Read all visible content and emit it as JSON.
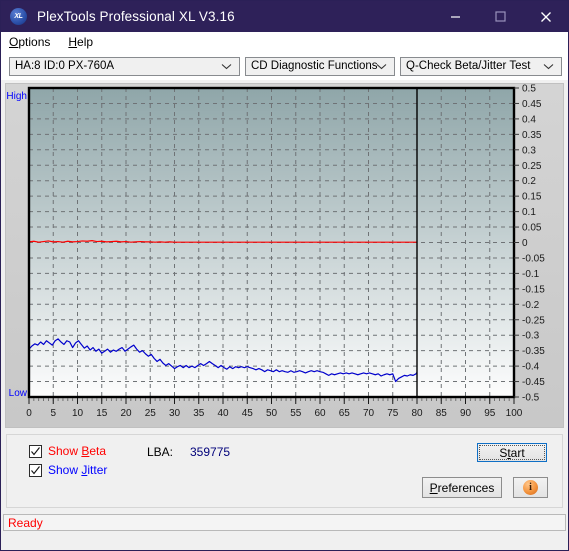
{
  "window": {
    "title": "PlexTools Professional XL V3.16",
    "icon": "XL",
    "app_icon_name": "plextools-logo-icon",
    "controls": {
      "minimize": "minimize-icon",
      "maximize": "maximize-icon",
      "close": "close-icon"
    },
    "titlebar_color": "#2e2159"
  },
  "menubar": {
    "items": [
      {
        "label": "Options",
        "accel": "O"
      },
      {
        "label": "Help",
        "accel": "H"
      }
    ]
  },
  "toolbar": {
    "drive_select": {
      "value": "HA:8 ID:0  PX-760A",
      "options": [
        "HA:8 ID:0  PX-760A"
      ]
    },
    "function_select": {
      "value": "CD Diagnostic Functions",
      "options": [
        "CD Diagnostic Functions"
      ]
    },
    "test_select": {
      "value": "Q-Check Beta/Jitter Test",
      "options": [
        "Q-Check Beta/Jitter Test"
      ]
    }
  },
  "options_panel": {
    "show_beta": {
      "label_pre": "Show ",
      "label_accel": "B",
      "label_post": "eta",
      "checked": true,
      "color": "#ff0000"
    },
    "show_jitter": {
      "label_pre": "Show ",
      "label_accel": "J",
      "label_post": "itter",
      "checked": true,
      "color": "#0000ff"
    },
    "lba_label": "LBA:",
    "lba_value": "359775",
    "start_button": {
      "label_pre": "S",
      "label_accel": "t",
      "label_post": "art",
      "focused": true
    },
    "preferences_button": {
      "label_pre": "",
      "label_accel": "P",
      "label_post": "references"
    },
    "info_button": {
      "glyph": "i",
      "name": "info-icon"
    }
  },
  "statusbar": {
    "text": "Ready",
    "color": "#ff0000"
  },
  "chart_data": {
    "type": "line",
    "title": "",
    "xlabel": "",
    "ylabel": "",
    "xlim": [
      0,
      100
    ],
    "ylim": [
      -0.5,
      0.5
    ],
    "grid": true,
    "legend": "none",
    "y_edge_labels": {
      "top": "High",
      "bottom": "Low",
      "color": "#0000ff"
    },
    "x_ticks": [
      0,
      5,
      10,
      15,
      20,
      25,
      30,
      35,
      40,
      45,
      50,
      55,
      60,
      65,
      70,
      75,
      80,
      85,
      90,
      95,
      100
    ],
    "y_ticks": [
      0.5,
      0.45,
      0.4,
      0.35,
      0.3,
      0.25,
      0.2,
      0.15,
      0.1,
      0.05,
      0,
      -0.05,
      -0.1,
      -0.15,
      -0.2,
      -0.25,
      -0.3,
      -0.35,
      -0.4,
      -0.45,
      -0.5
    ],
    "y_tick_labels": [
      "0.5",
      "0.45",
      "0.4",
      "0.35",
      "0.3",
      "0.25",
      "0.2",
      "0.15",
      "0.1",
      "0.05",
      "0",
      "-0.05",
      "-0.1",
      "-0.15",
      "-0.2",
      "-0.25",
      "-0.3",
      "-0.35",
      "-0.4",
      "-0.45",
      "-0.5"
    ],
    "plot_bg_gradient": [
      "#8fa6a9",
      "#fdfdfd"
    ],
    "data_end_marker_x": 80,
    "series": [
      {
        "name": "Beta",
        "color": "#ff0000",
        "x": [
          0,
          1,
          2,
          3,
          4,
          5,
          6,
          7,
          8,
          9,
          10,
          11,
          12,
          13,
          14,
          15,
          16,
          17,
          18,
          19,
          20,
          21,
          22,
          23,
          24,
          25,
          26,
          27,
          28,
          29,
          30,
          31,
          32,
          33,
          34,
          35,
          36,
          37,
          38,
          39,
          40,
          41,
          42,
          43,
          44,
          45,
          46,
          47,
          48,
          49,
          50,
          51,
          52,
          53,
          54,
          55,
          56,
          57,
          58,
          59,
          60,
          61,
          62,
          63,
          64,
          65,
          66,
          67,
          68,
          69,
          70,
          71,
          72,
          73,
          74,
          75,
          76,
          77,
          78,
          79,
          80
        ],
        "values": [
          0.002,
          0.004,
          0.001,
          0.003,
          0.005,
          0.002,
          0.003,
          0.001,
          0.004,
          0.002,
          0.003,
          0.005,
          0.004,
          0.006,
          0.003,
          0.004,
          0.002,
          0.003,
          0.004,
          0.002,
          0.003,
          0.001,
          0.002,
          0.003,
          0.002,
          0.002,
          0.001,
          0.002,
          0.001,
          0.002,
          0.001,
          0.001,
          0.001,
          0.001,
          0.001,
          0.001,
          0.001,
          0.001,
          0.001,
          0.001,
          0.001,
          0.001,
          0.001,
          0.001,
          0.001,
          0.001,
          0.001,
          0.001,
          0.001,
          0.001,
          0.001,
          0.001,
          0.001,
          0.001,
          0.001,
          0.001,
          0.001,
          0.001,
          0.001,
          0.001,
          0.001,
          0.001,
          0.001,
          0.001,
          0.001,
          0.001,
          0.001,
          0.001,
          0.001,
          0.001,
          0.001,
          0.001,
          0.001,
          0.001,
          0.001,
          0.001,
          0.001,
          0.001,
          0.001,
          0.001,
          0.001
        ]
      },
      {
        "name": "Jitter",
        "color": "#0000cc",
        "x": [
          0,
          0.6,
          1.2,
          1.8,
          2.4,
          3,
          3.6,
          4.2,
          4.8,
          5.4,
          6,
          6.6,
          7.2,
          7.8,
          8.4,
          9,
          9.6,
          10.2,
          10.8,
          11.4,
          12,
          12.6,
          13.2,
          13.8,
          14.4,
          15,
          15.6,
          16.2,
          16.8,
          17.4,
          18,
          18.6,
          19.2,
          19.8,
          20.4,
          21,
          21.6,
          22.2,
          22.8,
          23.4,
          24,
          24.6,
          25.2,
          25.8,
          26.4,
          27,
          27.6,
          28.2,
          28.8,
          29.4,
          30,
          30.6,
          31.2,
          31.8,
          32.4,
          33,
          33.6,
          34.2,
          34.8,
          35.4,
          36,
          36.6,
          37.2,
          37.8,
          38.4,
          39,
          39.6,
          40.2,
          40.8,
          41.4,
          42,
          42.6,
          43.2,
          43.8,
          44.4,
          45,
          45.6,
          46.2,
          46.8,
          47.4,
          48,
          48.6,
          49.2,
          49.8,
          50.4,
          51,
          51.6,
          52.2,
          52.8,
          53.4,
          54,
          54.6,
          55.2,
          55.8,
          56.4,
          57,
          57.6,
          58.2,
          58.8,
          59.4,
          60,
          60.6,
          61.2,
          61.8,
          62.4,
          63,
          63.6,
          64.2,
          64.8,
          65.4,
          66,
          66.6,
          67.2,
          67.8,
          68.4,
          69,
          69.6,
          70.2,
          70.8,
          71.4,
          72,
          72.6,
          73.2,
          73.8,
          74.4,
          75,
          75.6,
          76.2,
          76.8,
          77.4,
          78,
          78.6,
          79.2,
          79.8,
          80
        ],
        "values": [
          -0.345,
          -0.335,
          -0.328,
          -0.332,
          -0.322,
          -0.33,
          -0.318,
          -0.325,
          -0.332,
          -0.318,
          -0.312,
          -0.322,
          -0.33,
          -0.318,
          -0.322,
          -0.34,
          -0.325,
          -0.318,
          -0.33,
          -0.342,
          -0.335,
          -0.348,
          -0.34,
          -0.352,
          -0.345,
          -0.358,
          -0.352,
          -0.345,
          -0.355,
          -0.348,
          -0.352,
          -0.345,
          -0.34,
          -0.352,
          -0.345,
          -0.338,
          -0.332,
          -0.345,
          -0.355,
          -0.35,
          -0.36,
          -0.368,
          -0.362,
          -0.375,
          -0.385,
          -0.378,
          -0.39,
          -0.398,
          -0.392,
          -0.4,
          -0.408,
          -0.402,
          -0.398,
          -0.405,
          -0.398,
          -0.405,
          -0.4,
          -0.405,
          -0.398,
          -0.392,
          -0.398,
          -0.392,
          -0.385,
          -0.392,
          -0.398,
          -0.405,
          -0.398,
          -0.405,
          -0.41,
          -0.402,
          -0.408,
          -0.402,
          -0.405,
          -0.402,
          -0.405,
          -0.402,
          -0.405,
          -0.408,
          -0.412,
          -0.408,
          -0.412,
          -0.418,
          -0.412,
          -0.415,
          -0.418,
          -0.412,
          -0.418,
          -0.415,
          -0.418,
          -0.42,
          -0.415,
          -0.42,
          -0.418,
          -0.415,
          -0.418,
          -0.422,
          -0.418,
          -0.415,
          -0.418,
          -0.415,
          -0.418,
          -0.42,
          -0.425,
          -0.43,
          -0.425,
          -0.428,
          -0.425,
          -0.422,
          -0.425,
          -0.422,
          -0.425,
          -0.422,
          -0.425,
          -0.428,
          -0.425,
          -0.422,
          -0.425,
          -0.422,
          -0.425,
          -0.428,
          -0.425,
          -0.432,
          -0.428,
          -0.425,
          -0.428,
          -0.425,
          -0.45,
          -0.44,
          -0.435,
          -0.43,
          -0.432,
          -0.428,
          -0.43,
          -0.425,
          -0.42,
          -0.418
        ]
      }
    ]
  }
}
